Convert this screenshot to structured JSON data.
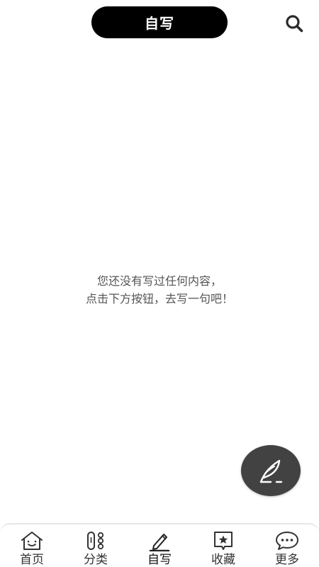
{
  "header": {
    "title": "自写",
    "search_icon": "search-icon"
  },
  "empty_state": {
    "line1": "您还没有写过任何内容，",
    "line2": "点击下方按钮，去写一句吧！"
  },
  "fab": {
    "icon": "quill-pen-icon",
    "color": "#424242"
  },
  "bottom_nav": {
    "items": [
      {
        "label": "首页",
        "icon": "home-icon"
      },
      {
        "label": "分类",
        "icon": "category-icon"
      },
      {
        "label": "自写",
        "icon": "pencil-icon",
        "active": true
      },
      {
        "label": "收藏",
        "icon": "favorite-star-icon"
      },
      {
        "label": "更多",
        "icon": "more-chat-icon"
      }
    ]
  },
  "colors": {
    "title_pill": "#000000",
    "background": "#ffffff",
    "text": "#555555"
  }
}
